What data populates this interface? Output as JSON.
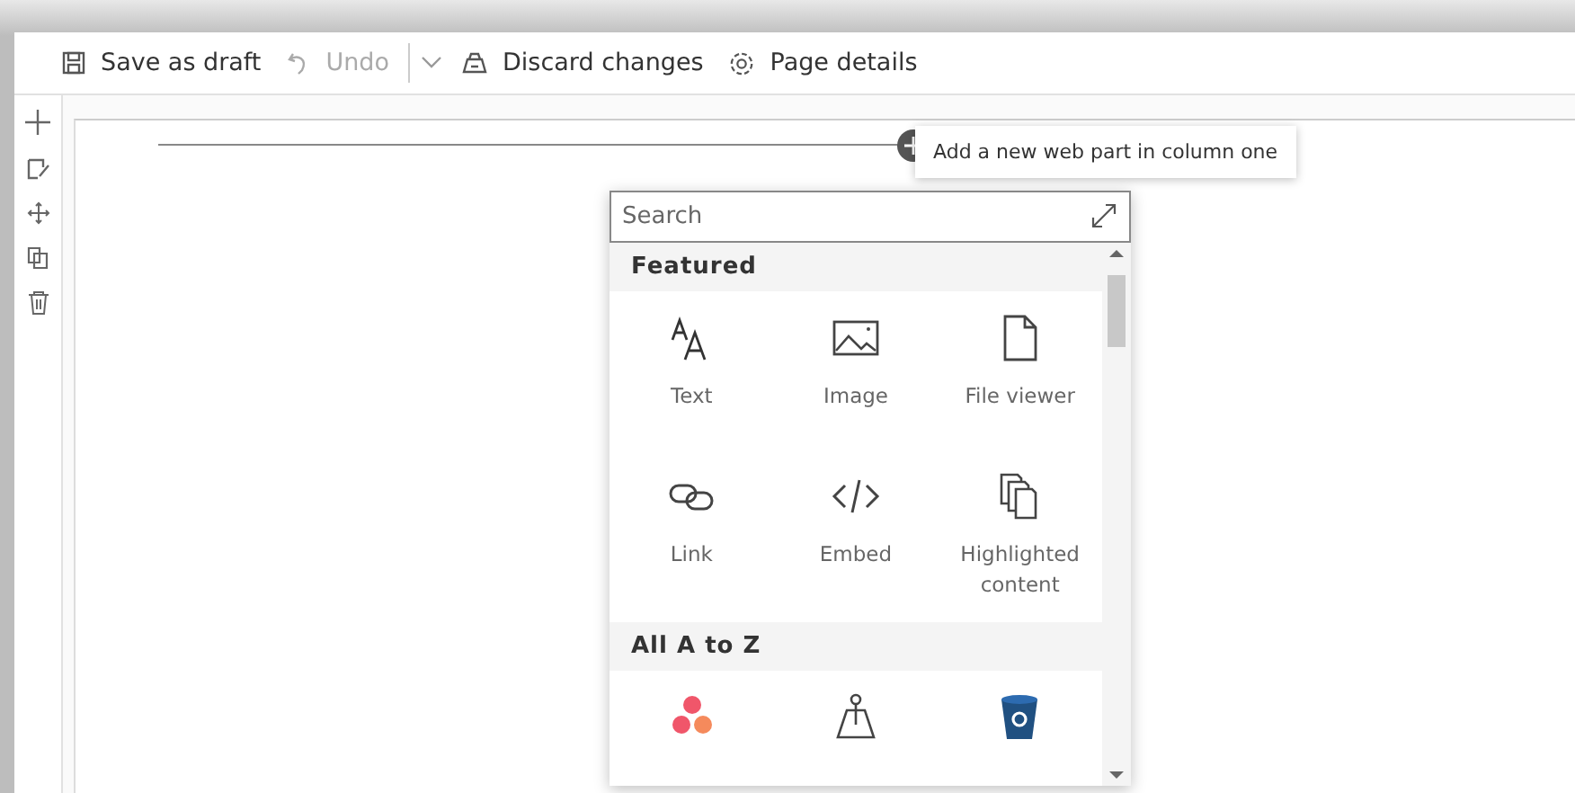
{
  "toolbar": {
    "items": [
      {
        "label": "Save as draft",
        "disabled": false
      },
      {
        "label": "Undo",
        "disabled": true
      },
      {
        "label": "Discard changes",
        "disabled": false
      },
      {
        "label": "Page details",
        "disabled": false
      }
    ]
  },
  "canvas": {
    "tooltip": "Add a new web part in column one"
  },
  "picker": {
    "search": {
      "placeholder": "Search"
    },
    "sections": [
      {
        "title": "Featured",
        "items": [
          {
            "kind": "labeled",
            "label": "Text"
          },
          {
            "kind": "labeled",
            "label": "Image"
          },
          {
            "kind": "labeled",
            "label": "File viewer"
          },
          {
            "kind": "labeled",
            "label": "Link"
          },
          {
            "kind": "labeled",
            "label": "Embed"
          },
          {
            "kind": "labeled",
            "label": "Highlighted content"
          }
        ]
      },
      {
        "title": "All A to Z",
        "items": [
          {
            "kind": "unlabeled"
          },
          {
            "kind": "unlabeled"
          },
          {
            "kind": "unlabeled"
          }
        ]
      }
    ]
  }
}
